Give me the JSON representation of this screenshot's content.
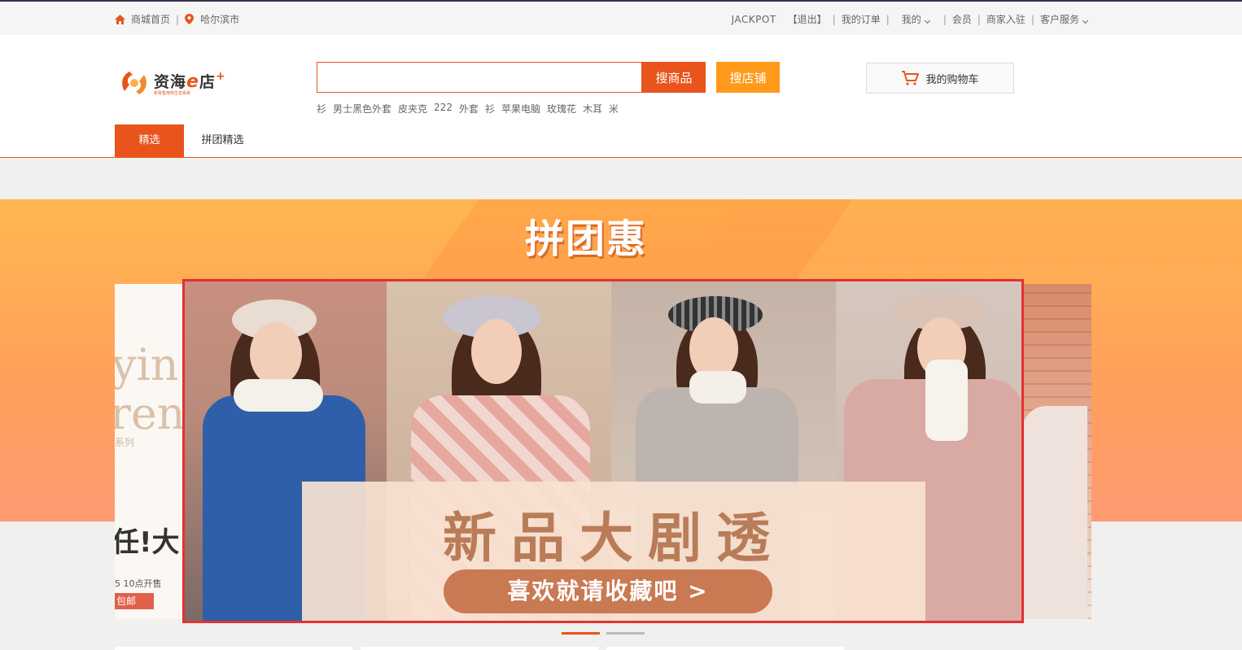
{
  "topbar": {
    "home": "商城首页",
    "city": "哈尔滨市",
    "user": "JACKPOT",
    "logout": "【退出】",
    "orders": "我的订单",
    "mine": "我的",
    "member": "会员",
    "merchant": "商家入驻",
    "service": "客户服务"
  },
  "logo": {
    "main_a": "资海",
    "main_e": "e",
    "main_b": "店",
    "plus": "+",
    "sub": "新零售电商生态系统"
  },
  "search": {
    "value": "",
    "btn_goods": "搜商品",
    "btn_shop": "搜店铺",
    "hot_words": [
      "衫",
      "男士黑色外套",
      "皮夹克",
      "222",
      "外套",
      "衫",
      "苹果电脑",
      "玫瑰花",
      "木耳",
      "米"
    ]
  },
  "cart": {
    "label": "我的购物车"
  },
  "nav": {
    "tabs": [
      "精选",
      "拼团精选"
    ]
  },
  "banner": {
    "title": "拼团惠",
    "promo_title": "新品大剧透",
    "promo_button": "喜欢就请收藏吧 >",
    "left_side": {
      "t1": "yin",
      "t2": "ren",
      "t3": "系列",
      "t4": "任!大",
      "t5": "5 10点开售",
      "t6": "包邮"
    },
    "carousel_active": 0,
    "carousel_count": 2
  },
  "colors": {
    "accent": "#e8541c",
    "shop_button": "#ff9a1a",
    "highlight_border": "#e53030"
  }
}
